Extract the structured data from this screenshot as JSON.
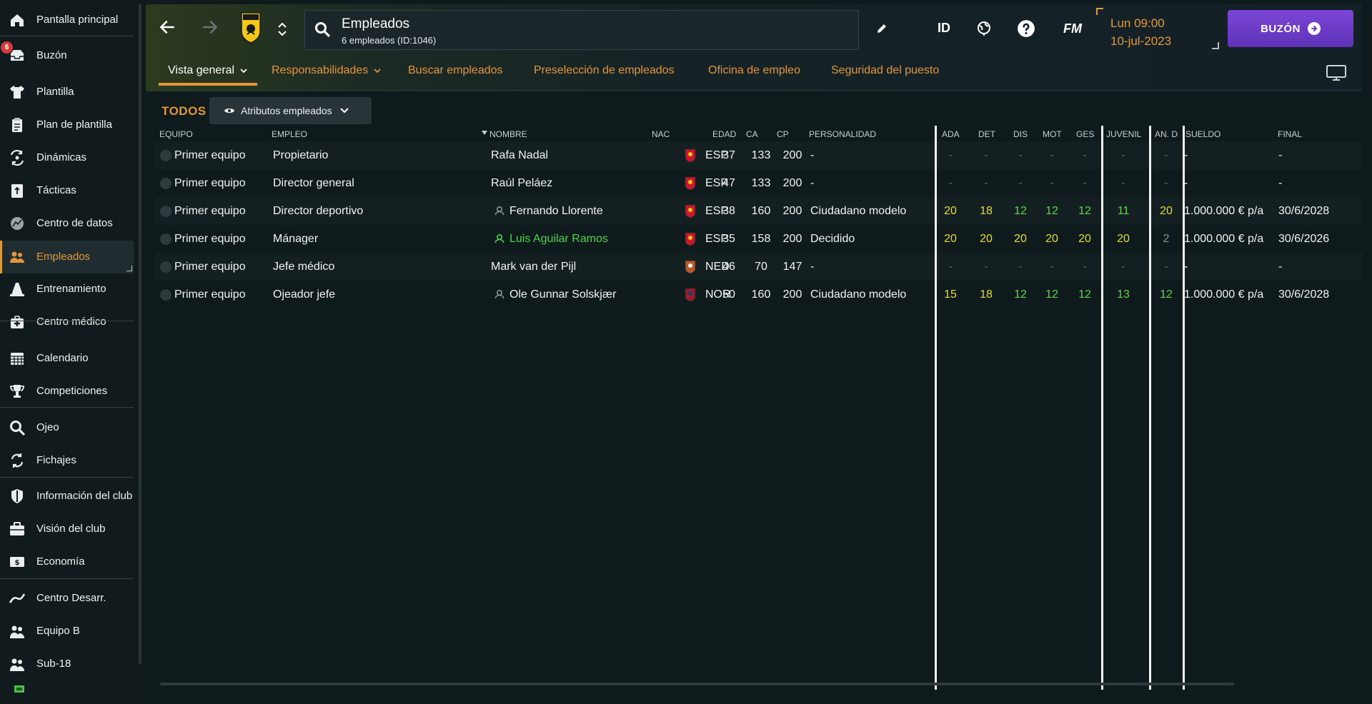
{
  "sidebar": {
    "items": [
      {
        "label": "Pantalla principal",
        "icon": "home-icon"
      },
      {
        "label": "Buzón",
        "icon": "inbox-icon",
        "badge": "6"
      },
      {
        "label": "Plantilla",
        "icon": "shirt-icon"
      },
      {
        "label": "Plan de plantilla",
        "icon": "clipboard-icon"
      },
      {
        "label": "Dinámicas",
        "icon": "dynamics-icon"
      },
      {
        "label": "Tácticas",
        "icon": "tactics-icon"
      },
      {
        "label": "Centro de datos",
        "icon": "data-center-icon"
      },
      {
        "label": "Empleados",
        "icon": "staff-icon"
      },
      {
        "label": "Entrenamiento",
        "icon": "training-cone-icon"
      },
      {
        "label": "Centro médico",
        "icon": "medical-kit-icon"
      },
      {
        "label": "Calendario",
        "icon": "calendar-icon"
      },
      {
        "label": "Competiciones",
        "icon": "trophy-icon"
      },
      {
        "label": "Ojeo",
        "icon": "magnifier-icon"
      },
      {
        "label": "Fichajes",
        "icon": "transfers-icon"
      },
      {
        "label": "Información del club",
        "icon": "club-shield-icon"
      },
      {
        "label": "Visión del club",
        "icon": "briefcase-icon"
      },
      {
        "label": "Economía",
        "icon": "money-icon"
      },
      {
        "label": "Centro Desarr.",
        "icon": "development-icon"
      },
      {
        "label": "Equipo B",
        "icon": "team-b-icon"
      },
      {
        "label": "Sub-18",
        "icon": "under-18-icon"
      }
    ]
  },
  "header": {
    "title": "Empleados",
    "subtitle": "6 empleados (ID:1046)",
    "id_label": "ID",
    "fm_label": "FM",
    "date_line1": "Lun 09:00",
    "date_line2": "10-jul-2023",
    "inbox_label": "BUZÓN"
  },
  "tabs": [
    {
      "label": "Vista general"
    },
    {
      "label": "Responsabilidades"
    },
    {
      "label": "Buscar empleados"
    },
    {
      "label": "Preselección de empleados"
    },
    {
      "label": "Oficina de empleo"
    },
    {
      "label": "Seguridad del puesto"
    }
  ],
  "filter": {
    "todos": "TODOS",
    "attributes_button": "Atributos empleados"
  },
  "table": {
    "columns": {
      "equipo": "EQUIPO",
      "empleo": "EMPLEO",
      "nombre": "NOMBRE",
      "nac": "NAC",
      "edad": "EDAD",
      "ca": "CA",
      "cp": "CP",
      "personalidad": "PERSONALIDAD",
      "ada": "ADA",
      "det": "DET",
      "dis": "DIS",
      "mot": "MOT",
      "ges": "GES",
      "juvenil": "JUVENIL",
      "and": "AN. D",
      "sueldo": "SUELDO",
      "final": "FINAL"
    },
    "rows": [
      {
        "equipo": "Primer equipo",
        "empleo": "Propietario",
        "nombre": "Rafa Nadal",
        "nac": "ESP",
        "edad": "37",
        "ca": "133",
        "cp": "200",
        "personalidad": "-",
        "ada": "-",
        "det": "-",
        "dis": "-",
        "mot": "-",
        "ges": "-",
        "juvenil": "-",
        "and": "-",
        "sueldo": "-",
        "final": "-"
      },
      {
        "equipo": "Primer equipo",
        "empleo": "Director general",
        "nombre": "Raúl Peláez",
        "nac": "ESP",
        "edad": "47",
        "ca": "133",
        "cp": "200",
        "personalidad": "-",
        "ada": "-",
        "det": "-",
        "dis": "-",
        "mot": "-",
        "ges": "-",
        "juvenil": "-",
        "and": "-",
        "sueldo": "-",
        "final": "-"
      },
      {
        "equipo": "Primer equipo",
        "empleo": "Director deportivo",
        "nombre": "Fernando Llorente",
        "nac": "ESP",
        "edad": "38",
        "ca": "160",
        "cp": "200",
        "personalidad": "Ciudadano modelo",
        "ada": "20",
        "det": "18",
        "dis": "12",
        "mot": "12",
        "ges": "12",
        "juvenil": "11",
        "and": "20",
        "sueldo": "1.000.000 € p/a",
        "final": "30/6/2028"
      },
      {
        "equipo": "Primer equipo",
        "empleo": "Mánager",
        "nombre": "Luis Aguilar Ramos",
        "nac": "ESP",
        "edad": "35",
        "ca": "158",
        "cp": "200",
        "personalidad": "Decidido",
        "ada": "20",
        "det": "20",
        "dis": "20",
        "mot": "20",
        "ges": "20",
        "juvenil": "20",
        "and": "2",
        "sueldo": "1.000.000 € p/a",
        "final": "30/6/2026"
      },
      {
        "equipo": "Primer equipo",
        "empleo": "Jefe médico",
        "nombre": "Mark van der Pijl",
        "nac": "NED",
        "edad": "46",
        "ca": "70",
        "cp": "147",
        "personalidad": "-",
        "ada": "-",
        "det": "-",
        "dis": "-",
        "mot": "-",
        "ges": "-",
        "juvenil": "-",
        "and": "-",
        "sueldo": "-",
        "final": "-"
      },
      {
        "equipo": "Primer equipo",
        "empleo": "Ojeador jefe",
        "nombre": "Ole Gunnar Solskjær",
        "nac": "NOR",
        "edad": "50",
        "ca": "160",
        "cp": "200",
        "personalidad": "Ciudadano modelo",
        "ada": "15",
        "det": "18",
        "dis": "12",
        "mot": "12",
        "ges": "12",
        "juvenil": "13",
        "and": "12",
        "sueldo": "1.000.000 € p/a",
        "final": "30/6/2028"
      }
    ]
  },
  "colors": {
    "accent_orange": "#e3963c",
    "inbox_purple": "#6f3ec8",
    "attr_high": "#e8dd2a",
    "attr_mid": "#5cd84a",
    "attr_low": "#8a9597"
  }
}
